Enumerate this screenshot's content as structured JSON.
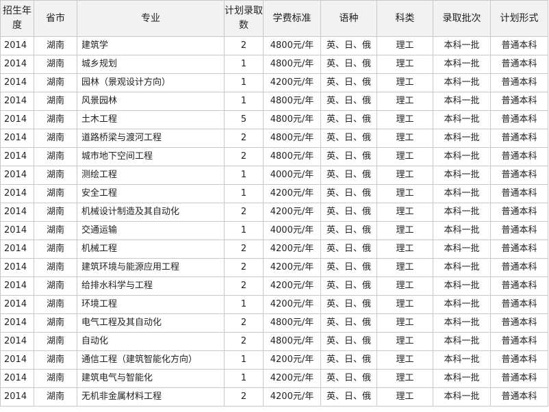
{
  "table": {
    "headers": [
      "招生年度",
      "省市",
      "专业",
      "计划录取数",
      "学费标准",
      "语种",
      "科类",
      "录取批次",
      "计划形式"
    ],
    "rows": [
      [
        "2014",
        "湖南",
        "建筑学",
        "2",
        "4800元/年",
        "英、日、俄",
        "理工",
        "本科一批",
        "普通本科"
      ],
      [
        "2014",
        "湖南",
        "城乡规划",
        "1",
        "4800元/年",
        "英、日、俄",
        "理工",
        "本科一批",
        "普通本科"
      ],
      [
        "2014",
        "湖南",
        "园林（景观设计方向）",
        "1",
        "4200元/年",
        "英、日、俄",
        "理工",
        "本科一批",
        "普通本科"
      ],
      [
        "2014",
        "湖南",
        "风景园林",
        "1",
        "4800元/年",
        "英、日、俄",
        "理工",
        "本科一批",
        "普通本科"
      ],
      [
        "2014",
        "湖南",
        "土木工程",
        "5",
        "4800元/年",
        "英、日、俄",
        "理工",
        "本科一批",
        "普通本科"
      ],
      [
        "2014",
        "湖南",
        "道路桥梁与渡河工程",
        "2",
        "4800元/年",
        "英、日、俄",
        "理工",
        "本科一批",
        "普通本科"
      ],
      [
        "2014",
        "湖南",
        "城市地下空间工程",
        "2",
        "4800元/年",
        "英、日、俄",
        "理工",
        "本科一批",
        "普通本科"
      ],
      [
        "2014",
        "湖南",
        "测绘工程",
        "1",
        "4000元/年",
        "英、日、俄",
        "理工",
        "本科一批",
        "普通本科"
      ],
      [
        "2014",
        "湖南",
        "安全工程",
        "1",
        "4200元/年",
        "英、日、俄",
        "理工",
        "本科一批",
        "普通本科"
      ],
      [
        "2014",
        "湖南",
        "机械设计制造及其自动化",
        "2",
        "4200元/年",
        "英、日、俄",
        "理工",
        "本科一批",
        "普通本科"
      ],
      [
        "2014",
        "湖南",
        "交通运输",
        "1",
        "4000元/年",
        "英、日、俄",
        "理工",
        "本科一批",
        "普通本科"
      ],
      [
        "2014",
        "湖南",
        "机械工程",
        "2",
        "4200元/年",
        "英、日、俄",
        "理工",
        "本科一批",
        "普通本科"
      ],
      [
        "2014",
        "湖南",
        "建筑环境与能源应用工程",
        "2",
        "4200元/年",
        "英、日、俄",
        "理工",
        "本科一批",
        "普通本科"
      ],
      [
        "2014",
        "湖南",
        "给排水科学与工程",
        "2",
        "4200元/年",
        "英、日、俄",
        "理工",
        "本科一批",
        "普通本科"
      ],
      [
        "2014",
        "湖南",
        "环境工程",
        "1",
        "4200元/年",
        "英、日、俄",
        "理工",
        "本科一批",
        "普通本科"
      ],
      [
        "2014",
        "湖南",
        "电气工程及其自动化",
        "2",
        "4800元/年",
        "英、日、俄",
        "理工",
        "本科一批",
        "普通本科"
      ],
      [
        "2014",
        "湖南",
        "自动化",
        "2",
        "4800元/年",
        "英、日、俄",
        "理工",
        "本科一批",
        "普通本科"
      ],
      [
        "2014",
        "湖南",
        "通信工程（建筑智能化方向）",
        "1",
        "4200元/年",
        "英、日、俄",
        "理工",
        "本科一批",
        "普通本科"
      ],
      [
        "2014",
        "湖南",
        "建筑电气与智能化",
        "1",
        "4200元/年",
        "英、日、俄",
        "理工",
        "本科一批",
        "普通本科"
      ],
      [
        "2014",
        "湖南",
        "无机非金属材料工程",
        "2",
        "4200元/年",
        "英、日、俄",
        "理工",
        "本科一批",
        "普通本科"
      ]
    ]
  }
}
